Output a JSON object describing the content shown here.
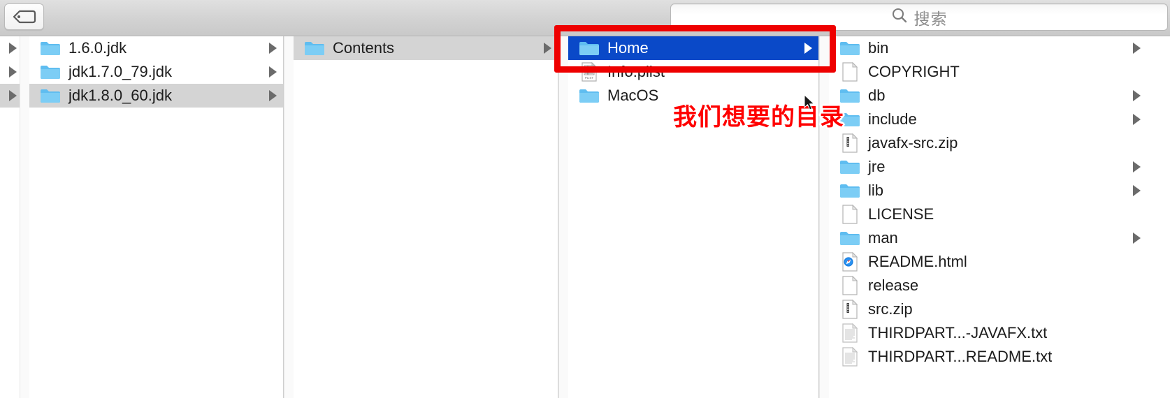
{
  "window": {
    "kind": "macos-finder-column-view"
  },
  "toolbar": {
    "tag_button_label": "Tags",
    "tag_icon": "tag-icon",
    "search": {
      "icon": "search-icon",
      "placeholder": "搜索",
      "value": ""
    }
  },
  "annotations": {
    "highlight_rect_color": "#ee0000",
    "note_text": "我们想要的目录",
    "note_color": "#ff0000",
    "cursor": "arrow-cursor"
  },
  "colors": {
    "selection_active": "#0a49c8",
    "selection_inactive": "#d4d4d4",
    "folder_blue": "#6fc4f0",
    "toolbar_bg": "#d2d2d2"
  },
  "columns": [
    {
      "name": "column-partial-left",
      "partial": true,
      "items": [
        {
          "label": "",
          "icon": "none",
          "has_children": true,
          "selected": "none"
        },
        {
          "label": "",
          "icon": "none",
          "has_children": true,
          "selected": "none"
        },
        {
          "label": "",
          "icon": "none",
          "has_children": true,
          "selected": "gray"
        }
      ]
    },
    {
      "name": "column-jdks",
      "partial": false,
      "items": [
        {
          "label": "1.6.0.jdk",
          "icon": "folder-icon",
          "has_children": true,
          "selected": "none"
        },
        {
          "label": "jdk1.7.0_79.jdk",
          "icon": "folder-icon",
          "has_children": true,
          "selected": "none"
        },
        {
          "label": "jdk1.8.0_60.jdk",
          "icon": "folder-icon",
          "has_children": true,
          "selected": "gray"
        }
      ]
    },
    {
      "name": "column-bundle",
      "partial": false,
      "items": [
        {
          "label": "Contents",
          "icon": "folder-icon",
          "has_children": true,
          "selected": "gray"
        }
      ]
    },
    {
      "name": "column-contents",
      "partial": false,
      "items": [
        {
          "label": "Home",
          "icon": "folder-icon",
          "has_children": true,
          "selected": "blue"
        },
        {
          "label": "Info.plist",
          "icon": "plist-file-icon",
          "has_children": false,
          "selected": "none"
        },
        {
          "label": "MacOS",
          "icon": "folder-icon",
          "has_children": false,
          "selected": "none"
        }
      ]
    },
    {
      "name": "column-home",
      "partial": false,
      "items": [
        {
          "label": "bin",
          "icon": "folder-icon",
          "has_children": true,
          "selected": "none"
        },
        {
          "label": "COPYRIGHT",
          "icon": "document-icon",
          "has_children": false,
          "selected": "none"
        },
        {
          "label": "db",
          "icon": "folder-icon",
          "has_children": true,
          "selected": "none"
        },
        {
          "label": "include",
          "icon": "folder-icon",
          "has_children": true,
          "selected": "none"
        },
        {
          "label": "javafx-src.zip",
          "icon": "zip-file-icon",
          "has_children": false,
          "selected": "none"
        },
        {
          "label": "jre",
          "icon": "folder-icon",
          "has_children": true,
          "selected": "none"
        },
        {
          "label": "lib",
          "icon": "folder-icon",
          "has_children": true,
          "selected": "none"
        },
        {
          "label": "LICENSE",
          "icon": "document-icon",
          "has_children": false,
          "selected": "none"
        },
        {
          "label": "man",
          "icon": "folder-icon",
          "has_children": true,
          "selected": "none"
        },
        {
          "label": "README.html",
          "icon": "safari-html-icon",
          "has_children": false,
          "selected": "none"
        },
        {
          "label": "release",
          "icon": "document-icon",
          "has_children": false,
          "selected": "none"
        },
        {
          "label": "src.zip",
          "icon": "zip-file-icon",
          "has_children": false,
          "selected": "none"
        },
        {
          "label": "THIRDPART...-JAVAFX.txt",
          "icon": "text-file-icon",
          "has_children": false,
          "selected": "none"
        },
        {
          "label": "THIRDPART...README.txt",
          "icon": "text-file-icon",
          "has_children": false,
          "selected": "none"
        }
      ]
    }
  ]
}
